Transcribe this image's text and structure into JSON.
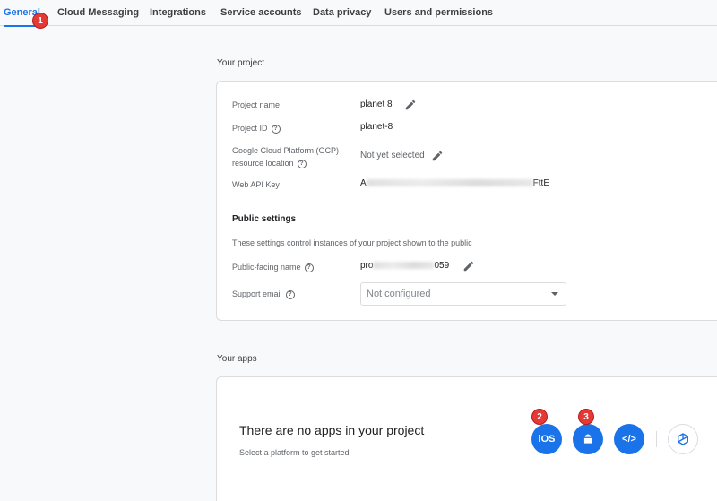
{
  "tabs": [
    {
      "label": "General",
      "active": true
    },
    {
      "label": "Cloud Messaging",
      "active": false
    },
    {
      "label": "Integrations",
      "active": false
    },
    {
      "label": "Service accounts",
      "active": false
    },
    {
      "label": "Data privacy",
      "active": false
    },
    {
      "label": "Users and permissions",
      "active": false
    }
  ],
  "annotations": [
    "1",
    "2",
    "3"
  ],
  "your_project": {
    "section_title": "Your project",
    "fields": {
      "project_name": {
        "label": "Project name",
        "value": "planet 8"
      },
      "project_id": {
        "label": "Project ID",
        "value": "planet-8"
      },
      "gcp_location": {
        "label_line1": "Google Cloud Platform (GCP)",
        "label_line2": "resource location",
        "value": "Not yet selected"
      },
      "web_api_key": {
        "label": "Web API Key",
        "value_prefix": "A",
        "value_suffix": "FttE"
      }
    },
    "public_settings": {
      "title": "Public settings",
      "hint": "These settings control instances of your project shown to the public",
      "public_name": {
        "label": "Public-facing name",
        "value_prefix": "pro",
        "value_suffix": "059"
      },
      "support_email": {
        "label": "Support email",
        "placeholder": "Not configured"
      }
    }
  },
  "your_apps": {
    "section_title": "Your apps",
    "empty_title": "There are no apps in your project",
    "empty_subtitle": "Select a platform to get started",
    "platforms": [
      {
        "name": "iOS",
        "label": "iOS"
      },
      {
        "name": "Android",
        "icon": "android-icon"
      },
      {
        "name": "Web",
        "icon": "code-icon",
        "label": "</>"
      },
      {
        "name": "Unity",
        "icon": "unity-icon"
      }
    ]
  }
}
